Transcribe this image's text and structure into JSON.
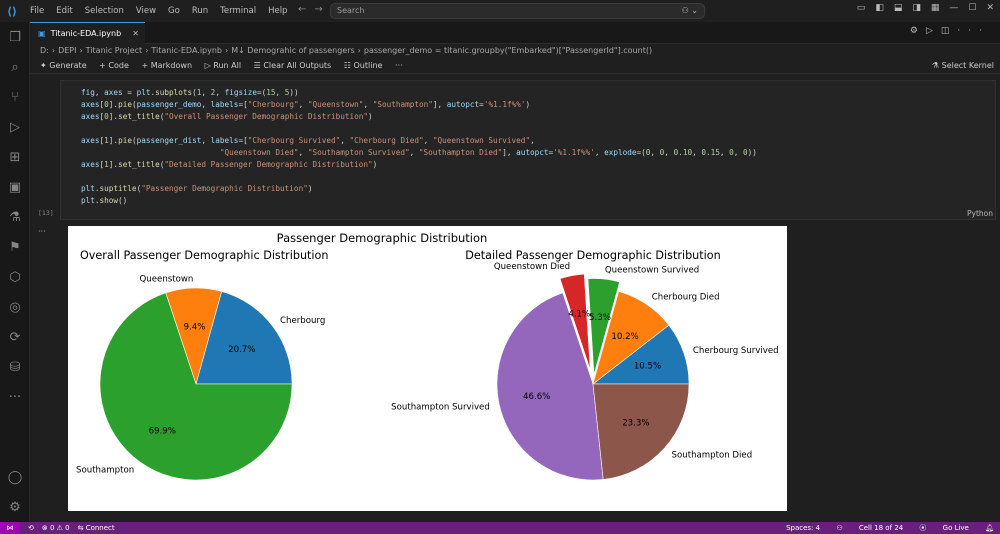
{
  "titlebar": {
    "menu": [
      "File",
      "Edit",
      "Selection",
      "View",
      "Go",
      "Run",
      "Terminal",
      "Help"
    ],
    "search_placeholder": "Search"
  },
  "tab": {
    "label": "Titanic-EDA.ipynb"
  },
  "breadcrumb": {
    "parts": [
      "D:",
      "DEPI",
      "Titanic Project",
      "Titanic-EDA.ipynb",
      "M↓ Demograhic of passengers",
      "passenger_demo = titanic.groupby(\"Embarked\")[\"PassengerId\"].count()"
    ]
  },
  "toolbar": {
    "generate": "Generate",
    "code": "+ Code",
    "markdown": "+ Markdown",
    "run_all": "Run All",
    "clear_all": "Clear All Outputs",
    "outline": "Outline",
    "more": "···",
    "kernel": "Select Kernel"
  },
  "cell": {
    "exec_count": "[13]",
    "language": "Python"
  },
  "chart_data": {
    "suptitle": "Passenger Demographic Distribution",
    "charts": [
      {
        "type": "pie",
        "title": "Overall Passenger Demographic Distribution",
        "labels": [
          "Cherbourg",
          "Queenstown",
          "Southampton"
        ],
        "values": [
          20.7,
          9.4,
          69.9
        ],
        "autopct": [
          "20.7%",
          "9.4%",
          "69.9%"
        ],
        "colors": [
          "#1f77b4",
          "#ff7f0e",
          "#2ca02c"
        ],
        "explode": [
          0,
          0,
          0
        ]
      },
      {
        "type": "pie",
        "title": "Detailed Passenger Demographic Distribution",
        "labels": [
          "Cherbourg Survived",
          "Cherbourg Died",
          "Queenstown Survived",
          "Queenstown Died",
          "Southampton Survived",
          "Southampton Died"
        ],
        "values": [
          10.5,
          10.2,
          5.3,
          4.1,
          46.6,
          23.3
        ],
        "autopct": [
          "10.5%",
          "10.2%",
          "5.3%",
          "4.1%",
          "46.6%",
          "23.3%"
        ],
        "colors": [
          "#1f77b4",
          "#ff7f0e",
          "#2ca02c",
          "#d62728",
          "#9467bd",
          "#8c564b"
        ],
        "explode": [
          0,
          0,
          0.1,
          0.15,
          0,
          0
        ]
      }
    ]
  },
  "status": {
    "connect": "Connect",
    "problems": "⊗ 0 ⚠ 0",
    "spaces": "Spaces: 4",
    "cell": "Cell 18 of 24",
    "golive": "Go Live"
  },
  "colors": {
    "accent": "#3c9be8",
    "statusbar": "#68217a"
  }
}
